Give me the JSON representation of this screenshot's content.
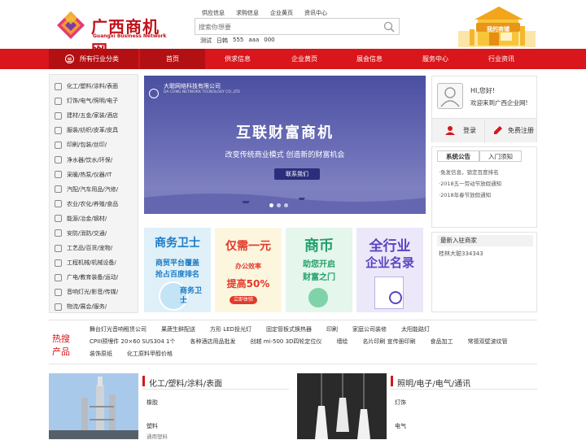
{
  "brand": {
    "name": "广西商机网",
    "en": "Guangxi Business Network",
    "color": "#c1121a"
  },
  "toplinks": [
    "供应信息",
    "求购信息",
    "企业黄页",
    "资讯中心"
  ],
  "search": {
    "placeholder": "搜索你想要"
  },
  "hotwords": [
    "测试",
    "日韩",
    "555",
    "aaa",
    "000"
  ],
  "shop": {
    "label": "我的商铺"
  },
  "nav": {
    "category_label": "所有行业分类",
    "items": [
      "首页",
      "供求信息",
      "企业黄页",
      "展会信息",
      "服务中心",
      "行业资讯"
    ],
    "active": 0,
    "color": "#d8161b"
  },
  "categories": [
    "化工/塑料/涂料/表面",
    "灯饰/电气/照明/电子",
    "建材/五金/家装/酒店",
    "服装/纺织/皮革/皮具",
    "印刷/包装/丝印/",
    "净水器/饮水/环保/",
    "采暖/热泵/仪器/IT",
    "汽配/汽车用品/汽修/",
    "农业/农化/养殖/食品",
    "能源/冶金/钢材/",
    "安防/消防/交通/",
    "工艺品/百货/宠物/",
    "工程机械/机械设备/",
    "广电/教育装备/运动/",
    "音响灯光/影音/传媒/",
    "物流/展会/服务/"
  ],
  "banner": {
    "company": "大聪网络科技有限公司",
    "company_en": "DA CONG NETWORK TECNOLOGY CO.,LTD",
    "headline": "互联财富商机",
    "subline": "改变传统商业模式   创造新的财富机会",
    "button": "联系我们"
  },
  "tiles": [
    {
      "title": "商务卫士",
      "line1": "商贸平台覆盖",
      "line2": "抢占百度排名",
      "badge": "商务卫士"
    },
    {
      "title": "仅需一元",
      "line1": "办公效率",
      "line2": "提高50%",
      "badge": "立即体验"
    },
    {
      "title": "商币",
      "line1": "助您开启",
      "line2": "财富之门"
    },
    {
      "title": "全行业",
      "line1": "企业名录"
    }
  ],
  "login": {
    "hi": "HI,您好!",
    "welcome": "欢迎来到广西企业网!",
    "login": "登录",
    "register": "免费注册"
  },
  "notice": {
    "tabs": [
      "系统公告",
      "入门须知"
    ],
    "items": [
      "·免发信息，锁定百度排名",
      "·2018五一劳动节放假通知",
      "·2018年春节放假通知"
    ]
  },
  "new_merchants": {
    "title": "最新入驻商家",
    "items": [
      "桂林大聪334343"
    ]
  },
  "hot": {
    "label": "热搜产品",
    "links": [
      "舞台灯光音响租赁公司",
      "果蔬生鲜配送",
      "方形 LED投光灯",
      "固定管板式换热器",
      "印刷",
      "家庭公司装修",
      "太阳能路灯",
      "CPIII预埋件 20×60 SUS304 1个",
      "各种酒店用品批发",
      "创越 mi-500 3D四轮定位仪",
      "墙绘",
      "名片印刷 宣传册印刷",
      "食品加工",
      "常德双壁波纹管",
      "装饰原纸",
      "化工原料甲醇价格"
    ]
  },
  "sections": [
    {
      "title": "化工/塑料/涂料/表面",
      "lines": [
        "橡胶",
        "塑料",
        "通用塑料"
      ]
    },
    {
      "title": "照明/电子/电气/通讯",
      "lines": [
        "灯饰",
        "电气"
      ]
    }
  ]
}
